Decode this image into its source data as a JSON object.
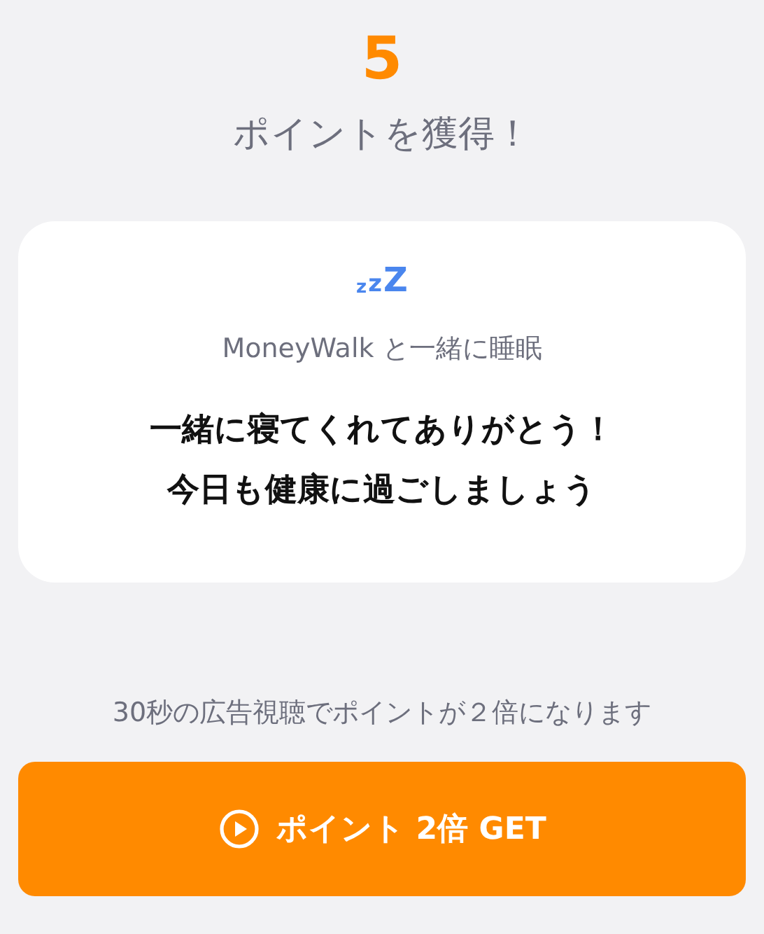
{
  "points": "5",
  "points_label": "ポイントを獲得！",
  "card": {
    "sleep_mark": "zzZ",
    "subtitle": "MoneyWalk と一緒に睡眠",
    "message": [
      "一緒に寝てくれてありがとう！",
      "今日も健康に過ごしましょう"
    ]
  },
  "ad_note": "30秒の広告視聴でポイントが２倍になります",
  "button": {
    "label": "ポイント 2倍 GET"
  }
}
